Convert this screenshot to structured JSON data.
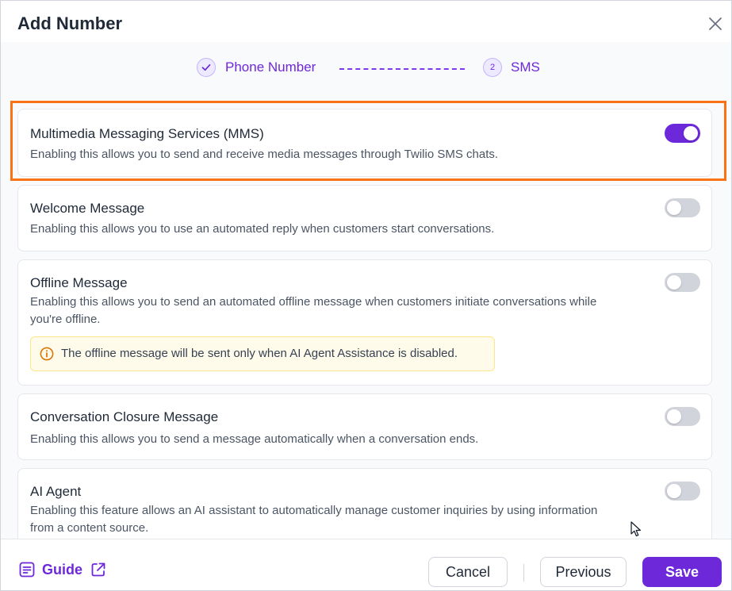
{
  "dialog": {
    "title": "Add Number",
    "close_icon": "close-icon"
  },
  "stepper": {
    "steps": [
      {
        "label": "Phone Number",
        "status": "completed",
        "icon": "check-icon"
      },
      {
        "number": "2",
        "label": "SMS",
        "status": "active"
      }
    ]
  },
  "settings": [
    {
      "title": "Multimedia Messaging Services (MMS)",
      "description": "Enabling this allows you to send and receive media messages through Twilio SMS chats.",
      "enabled": true,
      "highlighted": true
    },
    {
      "title": "Welcome Message",
      "description": "Enabling this allows you to use an automated reply when customers start conversations.",
      "enabled": false
    },
    {
      "title": "Offline Message",
      "description": "Enabling this allows you to send an automated offline message when customers initiate conversations while you're offline.",
      "enabled": false,
      "note": "The offline message will be sent only when AI Agent Assistance is disabled.",
      "note_icon": "info-icon"
    },
    {
      "title": "Conversation Closure Message",
      "description": "Enabling this allows you to send a message automatically when a conversation ends.",
      "enabled": false
    },
    {
      "title": "AI Agent",
      "description": "Enabling this feature allows an AI assistant to automatically manage customer inquiries by using information from a content source.",
      "enabled": false
    }
  ],
  "footer": {
    "guide_label": "Guide",
    "guide_icon": "document-icon",
    "external_icon": "external-link-icon",
    "cancel_label": "Cancel",
    "previous_label": "Previous",
    "save_label": "Save"
  },
  "colors": {
    "accent": "#6d28d9",
    "highlight": "#f97316",
    "note_bg": "#fffbeb",
    "note_icon": "#d97706"
  }
}
